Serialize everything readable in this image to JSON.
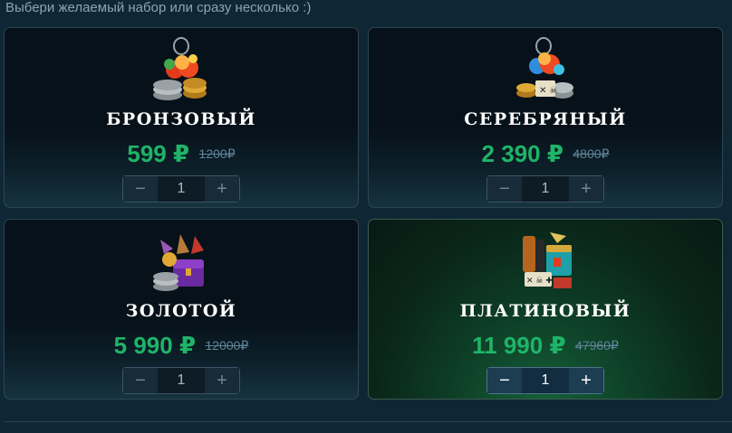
{
  "header": {
    "hint": "Выбери желаемый набор или сразу несколько :)"
  },
  "colors": {
    "accent_price": "#1fb468",
    "old_price": "#5f8498",
    "background": "#0f2734"
  },
  "packs": [
    {
      "icon": "bronze-pack-icon",
      "name": "БРОНЗОВЫЙ",
      "price": "599 ₽",
      "old_price": "1200₽",
      "quantity": "1",
      "minus": "−",
      "plus": "+"
    },
    {
      "icon": "silver-pack-icon",
      "name": "СЕРЕБРЯНЫЙ",
      "price": "2 390 ₽",
      "old_price": "4800₽",
      "quantity": "1",
      "minus": "−",
      "plus": "+"
    },
    {
      "icon": "gold-pack-icon",
      "name": "ЗОЛОТОЙ",
      "price": "5 990 ₽",
      "old_price": "12000₽",
      "quantity": "1",
      "minus": "−",
      "plus": "+"
    },
    {
      "icon": "platinum-pack-icon",
      "name": "ПЛАТИНОВЫЙ",
      "price": "11 990 ₽",
      "old_price": "47960₽",
      "quantity": "1",
      "minus": "−",
      "plus": "+"
    }
  ]
}
